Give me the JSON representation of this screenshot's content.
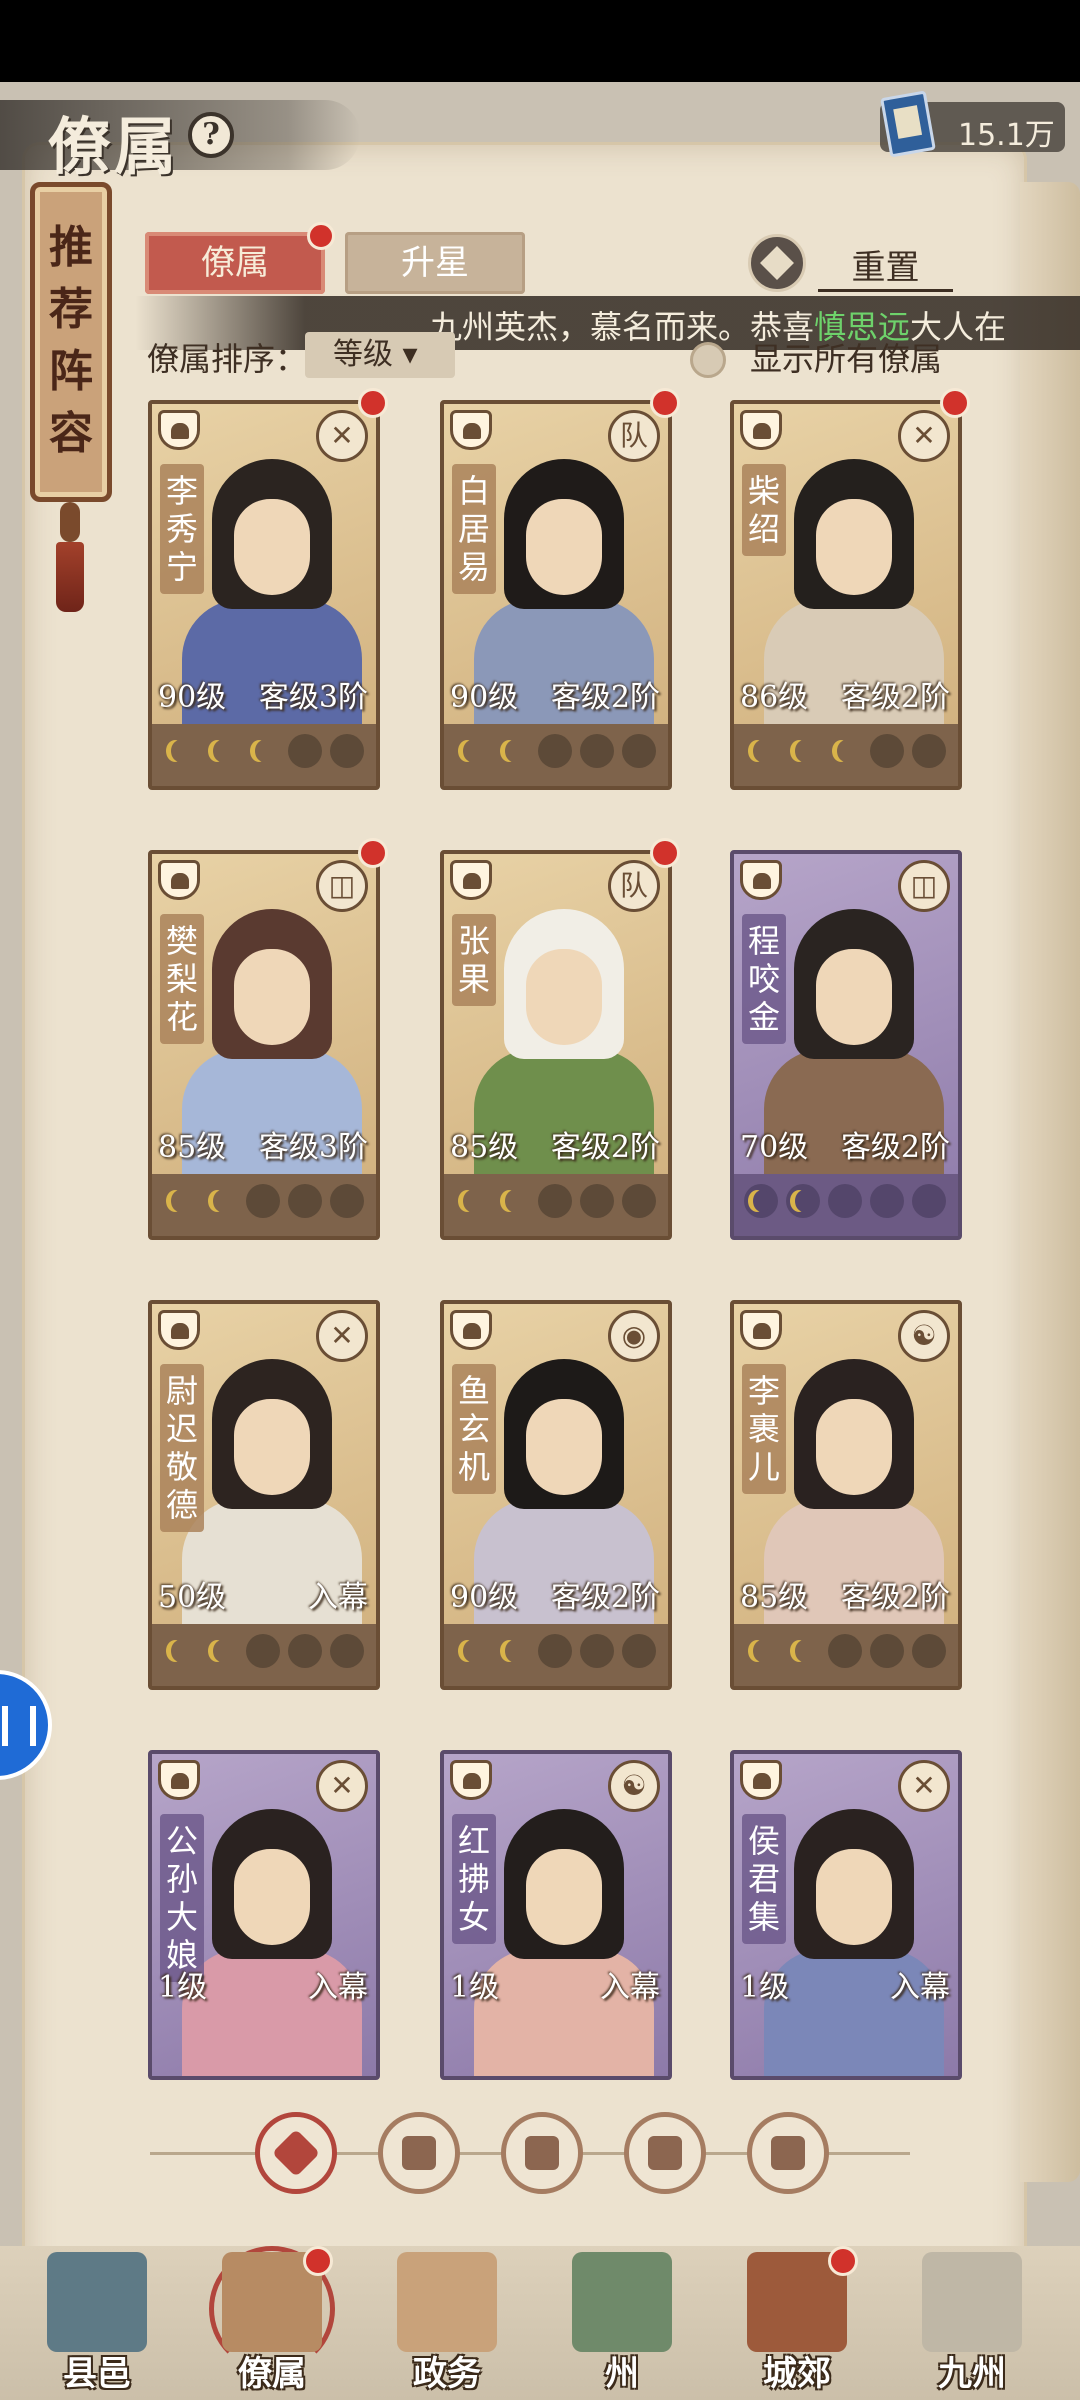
{
  "header": {
    "title": "僚属",
    "help_label": "?",
    "currency_value": "15.1万"
  },
  "recommend": {
    "label": "推荐阵容"
  },
  "tabs": [
    {
      "label": "僚属",
      "active": true
    },
    {
      "label": "升星",
      "active": false
    }
  ],
  "reset_label": "重置",
  "marquee": {
    "prefix": "九州英杰，慕名而来。恭喜",
    "highlight": "慎思远",
    "suffix": "大人在"
  },
  "sort": {
    "label": "僚属排序：",
    "value": "等级",
    "show_all_label": "显示所有僚属"
  },
  "cards": [
    {
      "name": "李秀宁",
      "level": "90级",
      "rank": "客级3阶",
      "stars": 3,
      "tier": "gold",
      "skill": "✕",
      "dot": true,
      "robe": "#5c6aa6",
      "hair": "#2b2420"
    },
    {
      "name": "白居易",
      "level": "90级",
      "rank": "客级2阶",
      "stars": 2,
      "tier": "gold",
      "skill": "队",
      "dot": true,
      "robe": "#8b98b8",
      "hair": "#1f1b19"
    },
    {
      "name": "柴绍",
      "level": "86级",
      "rank": "客级2阶",
      "stars": 3,
      "tier": "gold",
      "skill": "✕",
      "dot": true,
      "robe": "#d9cbb6",
      "hair": "#24201d"
    },
    {
      "name": "樊梨花",
      "level": "85级",
      "rank": "客级3阶",
      "stars": 2,
      "tier": "gold",
      "skill": "◫",
      "dot": true,
      "robe": "#a6b7d8",
      "hair": "#5a3a30"
    },
    {
      "name": "张果",
      "level": "85级",
      "rank": "客级2阶",
      "stars": 2,
      "tier": "gold",
      "skill": "队",
      "dot": true,
      "robe": "#6f8f4c",
      "hair": "#f1eee6"
    },
    {
      "name": "程咬金",
      "level": "70级",
      "rank": "客级2阶",
      "stars": 2,
      "tier": "purple",
      "skill": "◫",
      "dot": false,
      "robe": "#8a6a52",
      "hair": "#2a2421"
    },
    {
      "name": "尉迟敬德",
      "level": "50级",
      "rank": "入幕",
      "stars": 2,
      "tier": "gold",
      "skill": "✕",
      "dot": false,
      "robe": "#e6e0d3",
      "hair": "#2d2420"
    },
    {
      "name": "鱼玄机",
      "level": "90级",
      "rank": "客级2阶",
      "stars": 2,
      "tier": "gold",
      "skill": "◉",
      "dot": false,
      "robe": "#c8c1cf",
      "hair": "#1d1a18"
    },
    {
      "name": "李裹儿",
      "level": "85级",
      "rank": "客级2阶",
      "stars": 2,
      "tier": "gold",
      "skill": "☯",
      "dot": false,
      "robe": "#e0c7b8",
      "hair": "#2a2220"
    },
    {
      "name": "公孙大娘",
      "level": "1级",
      "rank": "入幕",
      "stars": 0,
      "tier": "purple",
      "skill": "✕",
      "dot": false,
      "robe": "#d99aa8",
      "hair": "#2a2220"
    },
    {
      "name": "红拂女",
      "level": "1级",
      "rank": "入幕",
      "stars": 0,
      "tier": "purple",
      "skill": "☯",
      "dot": false,
      "robe": "#e3b3a6",
      "hair": "#231e1c"
    },
    {
      "name": "侯君集",
      "level": "1级",
      "rank": "入幕",
      "stars": 0,
      "tier": "purple",
      "skill": "✕",
      "dot": false,
      "robe": "#7b87b8",
      "hair": "#2a2220"
    }
  ],
  "filters": [
    {
      "icon": "all-filter-icon",
      "active": true
    },
    {
      "icon": "helmet-filter-icon",
      "active": false
    },
    {
      "icon": "gourd-filter-icon",
      "active": false
    },
    {
      "icon": "fan-filter-icon",
      "active": false
    },
    {
      "icon": "lion-filter-icon",
      "active": false
    }
  ],
  "nav": [
    {
      "label": "县邑",
      "dot": false,
      "active": false,
      "color": "#5e7a86"
    },
    {
      "label": "僚属",
      "dot": true,
      "active": true,
      "color": "#b78b63"
    },
    {
      "label": "政务",
      "dot": false,
      "active": false,
      "color": "#c9a27a"
    },
    {
      "label": "州",
      "dot": false,
      "active": false,
      "color": "#6f8a6a"
    },
    {
      "label": "城郊",
      "dot": true,
      "active": false,
      "color": "#9d5a3b"
    },
    {
      "label": "九州",
      "dot": false,
      "active": false,
      "color": "#bfb7a6"
    }
  ]
}
